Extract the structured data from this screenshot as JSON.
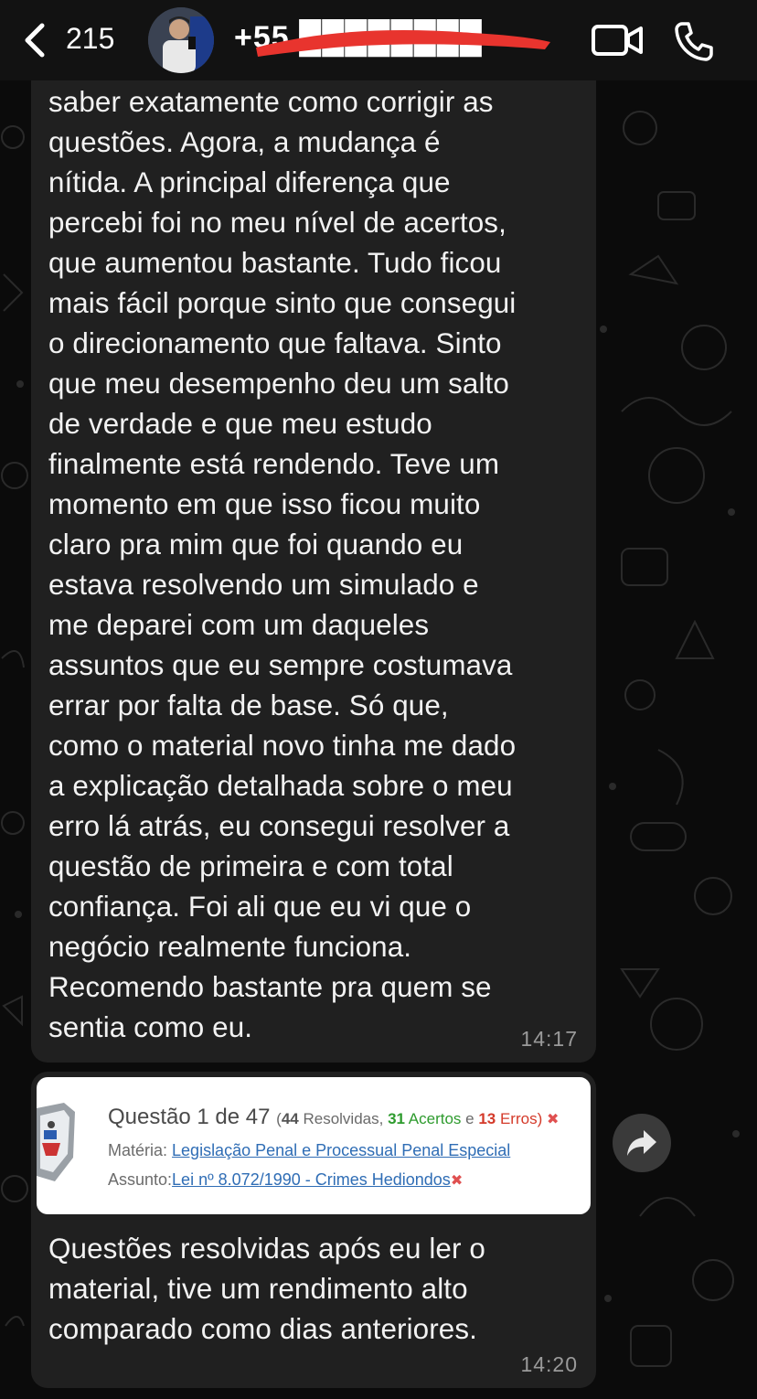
{
  "header": {
    "back_count": "215",
    "contact_name": "+55 ████████ ",
    "colors": {
      "background": "#121212",
      "redaction": "#e8342e"
    }
  },
  "messages": [
    {
      "text": "saber exatamente como corrigir as\nquestões. Agora, a mudança é\nnítida. A principal diferença que\npercebi foi no meu nível de acertos,\nque aumentou bastante. Tudo ficou\nmais fácil porque sinto que consegui\no direcionamento que faltava. Sinto\nque meu desempenho deu um salto\nde verdade e que meu estudo\nfinalmente está rendendo. Teve um\nmomento em que isso ficou muito\nclaro pra mim que foi quando eu\nestava resolvendo um simulado e\nme deparei com um daqueles\nassuntos que eu sempre costumava\nerrar por falta de base. Só que,\ncomo o material novo tinha me dado\na explicação detalhada sobre o meu\nerro lá atrás, eu consegui resolver a\nquestão de primeira e com total\nconfiança. Foi ali que eu vi que o\nnegócio realmente funciona.\nRecomendo bastante pra quem se\nsentia como eu.",
      "time": "14:17"
    },
    {
      "preview": {
        "title_prefix": "Questão 1 de 47",
        "open_paren": "(",
        "resolved_num": "44",
        "resolved_label": " Resolvidas, ",
        "correct_num": "31",
        "correct_label": " Acertos",
        "and": " e ",
        "errors_num": "13",
        "errors_label": " Erros)",
        "x_mark": "✖",
        "subject_label": "Matéria: ",
        "subject_value": "Legislação Penal e Processual Penal Especial",
        "topic_label": "Assunto:",
        "topic_value": "Lei nº 8.072/1990 - Crimes Hediondos",
        "topic_x": "✖"
      },
      "text": "Questões resolvidas após eu ler o\nmaterial, tive um rendimento alto\ncomparado como dias anteriores.",
      "time": "14:20"
    }
  ]
}
